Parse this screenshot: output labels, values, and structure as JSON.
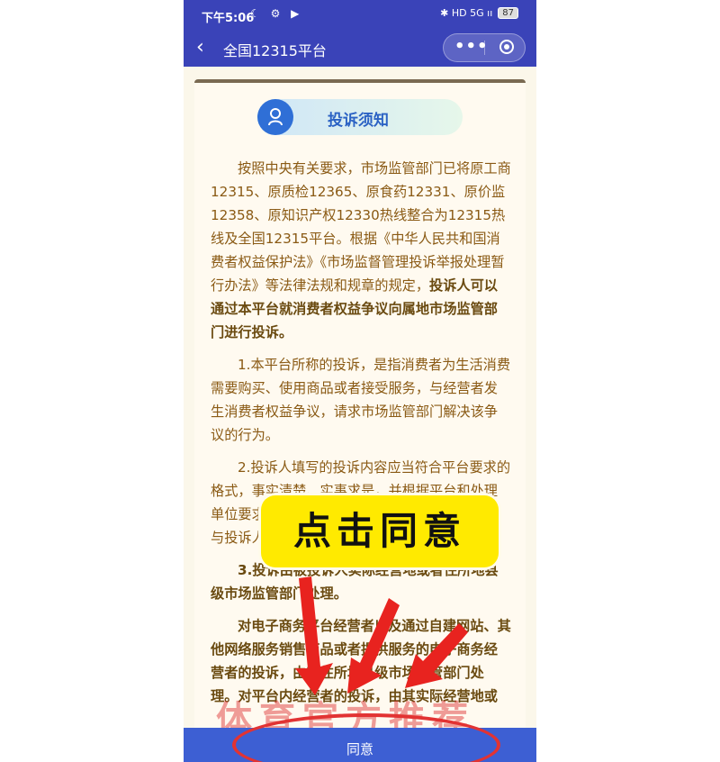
{
  "status_bar": {
    "time": "下午5:06",
    "icons_left": "☾ ⚙ ▶",
    "icons_right": "✱ HD 5G ıı",
    "battery": "87"
  },
  "nav": {
    "title": "全国12315平台",
    "more": "•••"
  },
  "notice": {
    "title": "投诉须知"
  },
  "paragraphs": {
    "p1_normal": "按照中央有关要求，市场监管部门已将原工商12315、原质检12365、原食药12331、原价监12358、原知识产权12330热线整合为12315热线及全国12315平台。根据《中华人民共和国消费者权益保护法》《市场监督管理投诉举报处理暂行办法》等法律法规和规章的规定，",
    "p1_bold": "投诉人可以通过本平台就消费者权益争议向属地市场监管部门进行投诉。",
    "p2": "1.本平台所称的投诉，是指消费者为生活消费需要购买、使用商品或者接受服务，与经营者发生消费者权益争议，请求市场监管部门解决该争议的行为。",
    "p3": "2.投诉人填写的投诉内容应当符合平台要求的格式，事实清楚、实事求是，并根据平台和处理单位要求提供相关资料，以便市场监管部门及时与投诉人取得联系。",
    "p4_bold": "3.投诉由被投诉人实际经营地或者住所地县级市场监管部门处理。",
    "p5": "对电子商务平台经营者以及通过自建网站、其他网络服务销售商品或者提供服务的电子商务经营者的投诉，由其住所地县级市场监管部门处理。对平台内经营者的投诉，由其实际经营地或"
  },
  "overlay": {
    "callout": "点击同意",
    "watermark": "体育官方推荐"
  },
  "agree_button": "同意",
  "colors": {
    "nav_bg": "#3a43b8",
    "text_brown": "#8a5a14",
    "callout_yellow": "#ffea00",
    "arrow_red": "#e8231f",
    "button_blue": "#3d5fd3"
  }
}
